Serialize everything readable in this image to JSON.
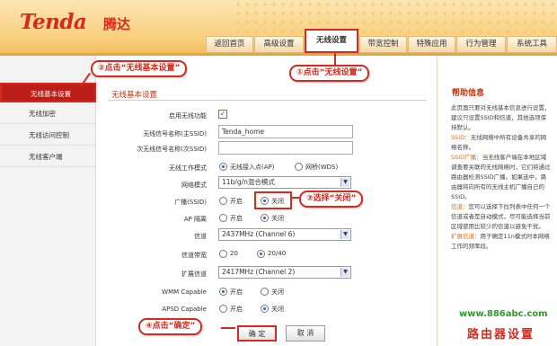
{
  "logo": {
    "brand": "Tenda",
    "brand_cn": "腾达"
  },
  "tabs": [
    "返回首页",
    "高级设置",
    "无线设置",
    "带宽控制",
    "特殊应用",
    "行为管理",
    "系统工具"
  ],
  "active_tab": "无线设置",
  "sidebar": {
    "items": [
      "无线基本设置",
      "无线加密",
      "无线访问控制",
      "无线客户端"
    ],
    "active": "无线基本设置"
  },
  "section_title": "无线基本设置",
  "form": {
    "enable_wireless": {
      "label": "启用无线功能",
      "checked": true
    },
    "primary_ssid": {
      "label": "无线信号名称(主SSID)",
      "value": "Tenda_home"
    },
    "secondary_ssid": {
      "label": "次无线信号名称(次SSID)",
      "value": ""
    },
    "mode": {
      "label": "无线工作模式",
      "options": [
        "无线接入点(AP)",
        "网桥(WDS)"
      ],
      "selected": "无线接入点(AP)"
    },
    "network_mode": {
      "label": "网络模式",
      "value": "11b/g/n混合模式"
    },
    "broadcast": {
      "label": "广播(SSID)",
      "options": [
        "开启",
        "关闭"
      ],
      "selected": "关闭"
    },
    "ap_isolation": {
      "label": "AP 隔离",
      "options": [
        "开启",
        "关闭"
      ],
      "selected": "关闭"
    },
    "channel": {
      "label": "信道",
      "value": "2437MHz (Channel 6)"
    },
    "bandwidth": {
      "label": "信道带宽",
      "options": [
        "20",
        "20/40"
      ],
      "selected": "20/40"
    },
    "ext_channel": {
      "label": "扩展信道",
      "value": "2417MHz (Channel 2)"
    },
    "wmm": {
      "label": "WMM Capable",
      "options": [
        "开启",
        "关闭"
      ],
      "selected": "开启"
    },
    "apsd": {
      "label": "APSD Capable",
      "options": [
        "开启",
        "关闭"
      ],
      "selected": "关闭"
    }
  },
  "buttons": {
    "ok": "确 定",
    "cancel": "取 消"
  },
  "annotations": {
    "step1": "①点击“无线设置”",
    "step2": "②点击“无线基本设置”",
    "step3": "③选择“关闭”",
    "step4": "④点击“确定”"
  },
  "help": {
    "title": "帮助信息",
    "p1": "此页面只要对无线基本信息进行设置，建议只设置SSID和信道，其他选项保持默认。",
    "ssid_label": "SSID：",
    "ssid_text": "无线网络中所有设备共享的网络名称。",
    "bcast_label": "SSID广播：",
    "bcast_text": "当无线客户端在本地区域调查要关联的无线网络时，它们将通过路由器检测SSID广播。如果选中，路由器将向所有的无线主机广播自己的SSID。",
    "chan_label": "信道：",
    "chan_text": "您可以选择下拉列表中任何一个信道或者是自动模式，尽可能选择当前区域使用比较少的信道以避免干扰。",
    "ext_label": "扩展信道：",
    "ext_text": "用于确定11n模式时本网络工作的频率段。"
  },
  "watermark": {
    "url": "www.886abc.com",
    "text": "路由器设置"
  }
}
